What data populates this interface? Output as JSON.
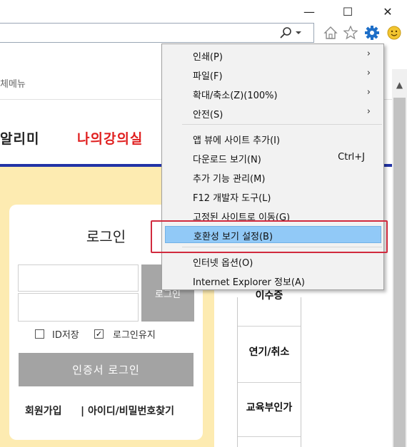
{
  "window": {
    "minimize": "—",
    "maximize": "☐",
    "close": "✕"
  },
  "toolbar": {
    "search_icon": "search-icon",
    "icons": [
      "home-icon",
      "favorites-star-icon",
      "tools-gear-icon",
      "smiley-feedback-icon"
    ],
    "accent_gear": "#1e6fc8",
    "accent_smiley": "#f2c530"
  },
  "page": {
    "menubar_text": "체메뉴",
    "nav_left": "알리미",
    "nav_right": "나의강의실",
    "colors": {
      "nav_line": "#2233a6",
      "nav_highlight": "#e01f1f",
      "panel_bg": "#fdebb1"
    },
    "login": {
      "title": "로그인",
      "button": "로그인",
      "save_id": "ID저장",
      "save_id_checked": false,
      "keep_login": "로그인유지",
      "keep_login_checked": true,
      "check_mark": "✓",
      "cert_button": "인증서 로그인",
      "signup": "회원가입",
      "find": "| 아이디/비밀번호찾기"
    },
    "side_table": [
      "이수증",
      "연기/취소",
      "교육부인가"
    ]
  },
  "tools_menu": {
    "items": [
      {
        "label": "인쇄(P)",
        "arrow": "›"
      },
      {
        "label": "파일(F)",
        "arrow": "›"
      },
      {
        "label": "확대/축소(Z)(100%)",
        "arrow": "›"
      },
      {
        "label": "안전(S)",
        "arrow": "›"
      },
      {
        "label": "앱 뷰에 사이트 추가(I)"
      },
      {
        "label": "다운로드 보기(N)",
        "shortcut": "Ctrl+J"
      },
      {
        "label": "추가 기능 관리(M)"
      },
      {
        "label": "F12 개발자 도구(L)"
      },
      {
        "label": "고정된 사이트로 이동(G)"
      },
      {
        "label": "호환성 보기 설정(B)",
        "highlighted": true
      },
      {
        "label": "인터넷 옵션(O)"
      },
      {
        "label": "Internet Explorer 정보(A)"
      }
    ],
    "highlight_color": "#91c9f7",
    "callout_color": "#d12a3e"
  },
  "scrollbar": {
    "up_arrow": "▲"
  }
}
